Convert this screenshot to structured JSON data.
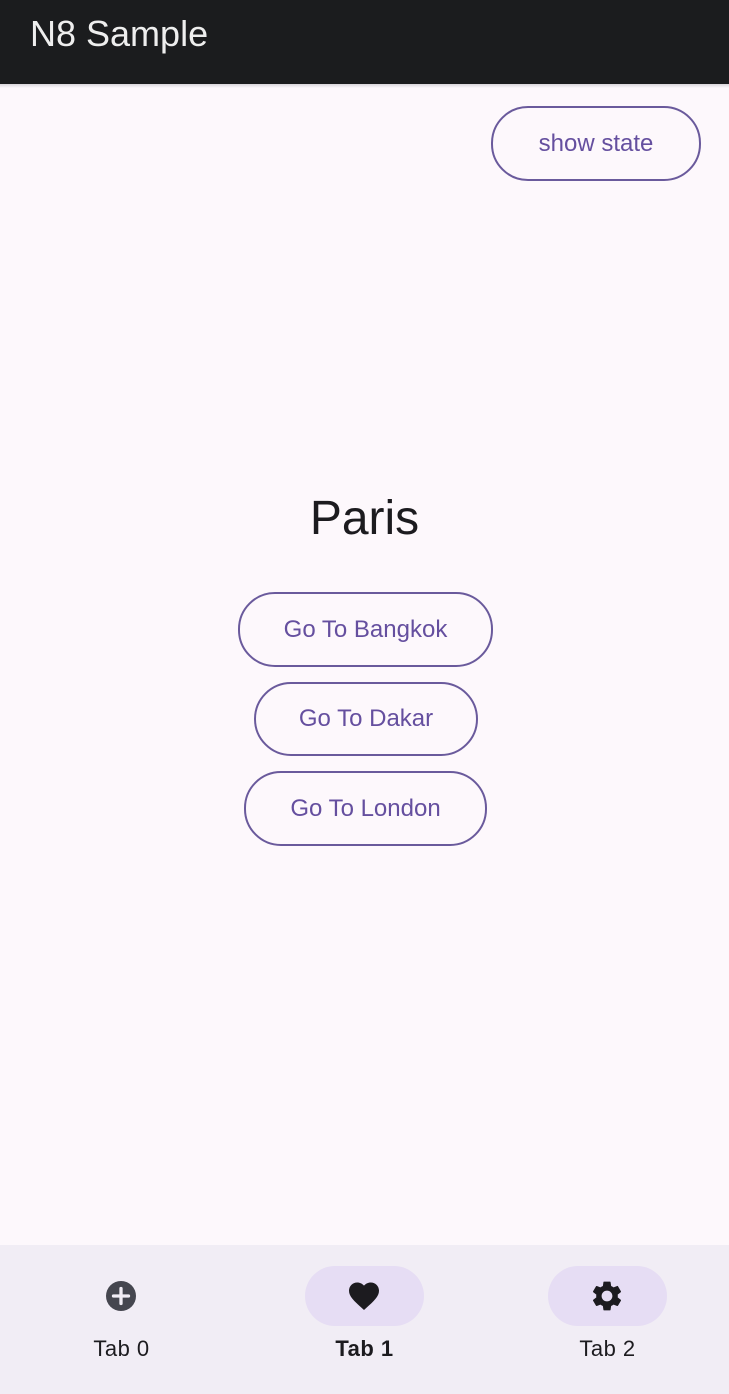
{
  "app_bar": {
    "title": "N8 Sample"
  },
  "actions": {
    "show_state_label": "show state"
  },
  "screen": {
    "city": "Paris"
  },
  "navigation_buttons": [
    {
      "label": "Go To Bangkok"
    },
    {
      "label": "Go To Dakar"
    },
    {
      "label": "Go To London"
    }
  ],
  "bottom_nav": {
    "tabs": [
      {
        "label": "Tab 0",
        "icon": "add-circle-icon",
        "selected": false,
        "highlighted": false
      },
      {
        "label": "Tab 1",
        "icon": "heart-icon",
        "selected": true,
        "highlighted": true
      },
      {
        "label": "Tab 2",
        "icon": "gear-icon",
        "selected": false,
        "highlighted": true
      }
    ]
  },
  "colors": {
    "app_bar": "#1b1c1e",
    "background": "#fdf8fc",
    "accent": "#654f9f",
    "bottom_bar": "#f1edf5",
    "indicator": "#e6ddf4"
  }
}
